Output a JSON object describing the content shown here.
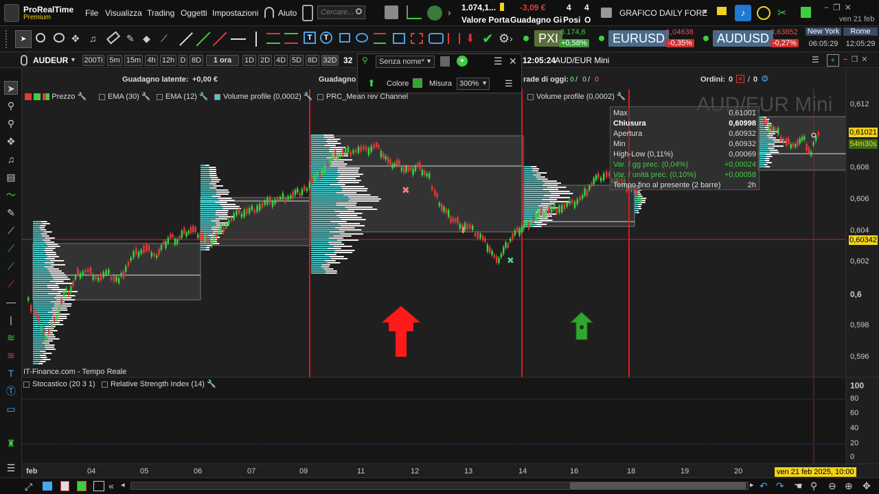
{
  "app": {
    "name": "ProRealTime",
    "edition": "Premium"
  },
  "menu": {
    "items": [
      "File",
      "Visualizza",
      "Trading",
      "Oggetti",
      "Impostazioni"
    ],
    "help": "Aiuto",
    "search_placeholder": "Cercare..."
  },
  "account": {
    "portfolio_value": "1.074,1...",
    "portfolio_label": "Valore Porta",
    "daily_gain": "-3,09 €",
    "daily_gain_label": "Guadagno Gi",
    "positions_count": "4",
    "positions_label": "Posi",
    "orders_count": "4",
    "orders_label": "O",
    "window_title": "GRAFICO DAILY FORE"
  },
  "tickers": [
    {
      "symbol": "PXI",
      "value": "8.174,6",
      "change": "+0,58%",
      "change_color": "#3c9a3c"
    },
    {
      "symbol": "EURUSD",
      "value": "1,04638",
      "change": "-0,35%",
      "change_color": "#d03030"
    },
    {
      "symbol": "AUDUSD",
      "value": "0,63852",
      "change": "-0,27%",
      "change_color": "#d03030"
    }
  ],
  "clocks": [
    {
      "city": "New York",
      "time": "06:05:29"
    },
    {
      "city": "Rome",
      "time": "12:05:29"
    }
  ],
  "date_top": "ven 21 feb",
  "chart_toolbar": {
    "instrument": "AUDEUR",
    "units": "200Ti",
    "timeframes": [
      "5m",
      "15m",
      "4h",
      "12h",
      "D",
      "8D"
    ],
    "selected_tf": "1 ora",
    "ranges": [
      "1D",
      "2D",
      "4D",
      "5D",
      "8D",
      "32D"
    ],
    "extra": "32",
    "time": "12:05:24",
    "title": "AUD/EUR Mini"
  },
  "popup": {
    "name": "Senza nome*",
    "color_label": "Colore",
    "size_label": "Misura",
    "size_value": "300%"
  },
  "stats": {
    "latent_gain_label": "Guadagno latente:",
    "latent_gain": "+0,00 €",
    "latent_gain2_label": "Guadagno",
    "trades_today_label": "rade di oggi:",
    "trades_today": [
      "0",
      "0",
      "0"
    ],
    "orders_label": "Ordini:",
    "orders": [
      "0",
      "0"
    ]
  },
  "indicators_top": [
    {
      "name": "Prezzo"
    },
    {
      "name": "EMA (30)"
    },
    {
      "name": "EMA (12)"
    },
    {
      "name": "Volume profile (0,0002)"
    },
    {
      "name": "PRC_Mean rev Channel"
    },
    {
      "name": "Volume profile (0,0002)"
    }
  ],
  "watermark": "AUD/EUR Mini",
  "info_box": [
    {
      "k": "Max",
      "v": "0,61001",
      "bold": false
    },
    {
      "k": "Chiusura",
      "v": "0,60998",
      "bold": true
    },
    {
      "k": "Apertura",
      "v": "0,60932",
      "bold": false
    },
    {
      "k": "Min",
      "v": "0,60932",
      "bold": false
    },
    {
      "k": "High-Low (0,11%)",
      "v": "0,00069",
      "bold": false
    },
    {
      "k": "Var. / gg prec. (0,04%)",
      "v": "+0,00024",
      "bold": false,
      "green": true
    },
    {
      "k": "Var. / unità prec. (0,10%)",
      "v": "+0,00058",
      "bold": false,
      "green": true
    },
    {
      "k": "Tempo fino al presente (2 barre)",
      "v": "2h",
      "bold": false
    }
  ],
  "price_axis": {
    "ticks": [
      "0,612",
      "0,608",
      "0,606",
      "0,604",
      "0,602",
      "0,6",
      "0,598",
      "0,596"
    ],
    "current_price": "0,61021",
    "countdown": "54m30s",
    "hline_price": "0,60342"
  },
  "source": "IT-Finance.com - Tempo Reale",
  "indicators_bottom": [
    {
      "name": "Stocastico (20 3 1)"
    },
    {
      "name": "Relative Strength Index (14)"
    }
  ],
  "osc_axis": [
    "100",
    "80",
    "60",
    "40",
    "20",
    "0"
  ],
  "date_axis": [
    "feb",
    "04",
    "05",
    "06",
    "07",
    "09",
    "11",
    "12",
    "13",
    "14",
    "16",
    "18",
    "19",
    "20"
  ],
  "cursor_date": "ven 21 feb 2025, 10:00",
  "colors": {
    "bull": "#3ecf3e",
    "bear": "#e03a3a",
    "profile_cyan": "#48c8c8",
    "profile_white": "#f0f0f0",
    "signal_red": "#ff1a1a",
    "signal_green": "#2fa82f",
    "accent_yellow": "#f2d21b"
  }
}
